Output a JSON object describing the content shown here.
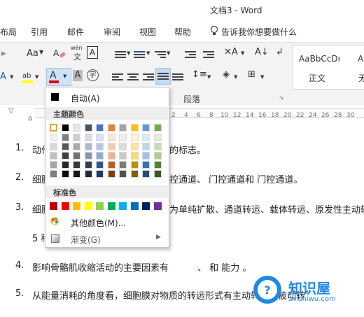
{
  "window": {
    "title": "文档3  -  Word"
  },
  "tabs": [
    "布局",
    "引用",
    "邮件",
    "审阅",
    "视图",
    "帮助"
  ],
  "tell_me": "告诉我你想要做什么",
  "ribbon": {
    "font_size_label": "Aa",
    "phonetic_label": "wén",
    "border_char": "A",
    "styles_preview": [
      "AaBbCcDı",
      "AaB"
    ],
    "style_names": [
      "正文",
      "无"
    ],
    "group_label_paragraph": "段落"
  },
  "ruler": {
    "numbers": [
      "2",
      "4",
      "6",
      "8",
      "10",
      "12",
      "14",
      "16",
      "18",
      "20",
      "22",
      "24",
      "26",
      "28",
      "30"
    ]
  },
  "color_menu": {
    "auto_label": "自动(A)",
    "theme_header": "主题颜色",
    "standard_header": "标准色",
    "more_colors_label": "其他颜色(M)...",
    "gradient_label": "渐变(G)",
    "theme_colors": [
      [
        "#FFFFFF",
        "#F2F2F2",
        "#D9D9D9",
        "#BFBFBF",
        "#A6A6A6",
        "#7F7F7F"
      ],
      [
        "#000000",
        "#7F7F7F",
        "#595959",
        "#404040",
        "#262626",
        "#0D0D0D"
      ],
      [
        "#E7E6E6",
        "#D0CECE",
        "#AEAAAA",
        "#757171",
        "#3A3838",
        "#171616"
      ],
      [
        "#44546A",
        "#D6DCE4",
        "#ADB9CA",
        "#8497B0",
        "#333F4F",
        "#222A35"
      ],
      [
        "#4472C4",
        "#D9E2F3",
        "#B4C6E7",
        "#8EAADB",
        "#2F5496",
        "#1F3864"
      ],
      [
        "#ED7D31",
        "#FBE5D5",
        "#F7CBAC",
        "#F4B183",
        "#C55A11",
        "#833C0B"
      ],
      [
        "#A5A5A5",
        "#EDEDED",
        "#DBDBDB",
        "#C9C9C9",
        "#7B7B7B",
        "#525252"
      ],
      [
        "#FFC000",
        "#FFF2CC",
        "#FFE599",
        "#FFD966",
        "#BF9000",
        "#7F6000"
      ],
      [
        "#5B9BD5",
        "#DEEBF6",
        "#BDD7EE",
        "#9DC3E6",
        "#2E75B5",
        "#1F4E79"
      ],
      [
        "#70AD47",
        "#E2EFD9",
        "#C5E0B3",
        "#A8D08D",
        "#538135",
        "#375623"
      ]
    ],
    "standard_colors": [
      "#C00000",
      "#FF0000",
      "#FFC000",
      "#FFFF00",
      "#92D050",
      "#00B050",
      "#00B0F0",
      "#0070C0",
      "#002060",
      "#7030A0"
    ]
  },
  "document": {
    "items": [
      {
        "num": "1.",
        "left": "动作",
        "right": "的标志。"
      },
      {
        "num": "2.",
        "left": "细胞",
        "right": "控通道、       门控通道和       门控通道。"
      },
      {
        "num": "3.",
        "left": "细胞",
        "right": "为单纯扩散、通道转运、载体转运、原发性主动转"
      },
      {
        "num": "",
        "left": "5 种",
        "right": ""
      },
      {
        "num": "4.",
        "left": "影响骨骼肌收缩活动的主要因素有",
        "right": "、           和           能力  。"
      },
      {
        "num": "5.",
        "left": "从能量消耗的角度看，细胞膜对物质的转运形式有主动转运和被动转",
        "right": ""
      }
    ]
  },
  "watermark": {
    "name": "知识屋",
    "url": "zhishiwu.com"
  }
}
